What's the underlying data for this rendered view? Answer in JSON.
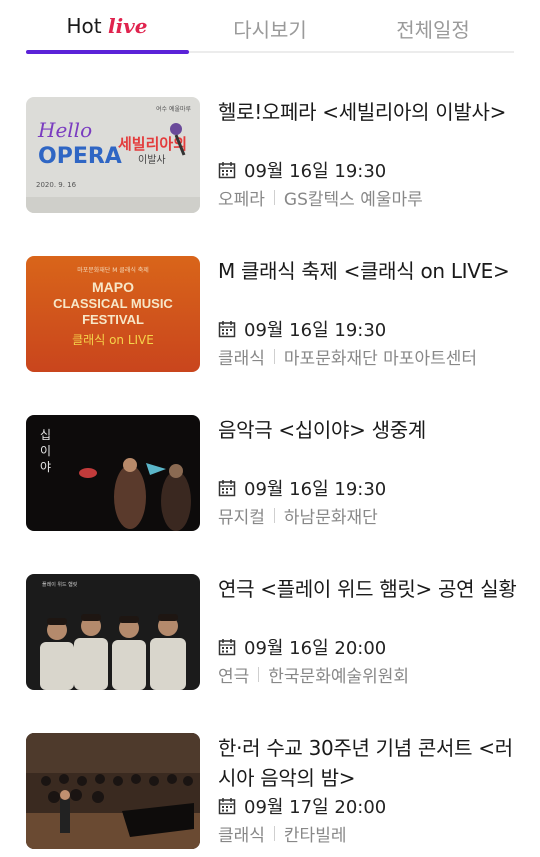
{
  "tabs": {
    "hot_prefix": "Hot",
    "hot_live": "live",
    "replay": "다시보기",
    "schedule": "전체일정"
  },
  "events": [
    {
      "title": "헬로!오페라 <세빌리아의 이발사>",
      "date": "09월 16일 19:30",
      "category": "오페라",
      "venue": "GS칼텍스 예울마루",
      "poster": {
        "line1": "Hello",
        "line2": "OPERA",
        "kr": "세빌리아의",
        "kr2": "이발사",
        "date": "2020. 9. 16",
        "top": "여수 예울마루"
      }
    },
    {
      "title": "M 클래식 축제 <클래식 on LIVE>",
      "date": "09월 16일 19:30",
      "category": "클래식",
      "venue": "마포문화재단 마포아트센터",
      "poster": {
        "top": "마포문화재단 M 클래식 축제",
        "line1": "MAPO",
        "line2": "CLASSICAL MUSIC",
        "line3": "FESTIVAL",
        "line4": "클래식 on LIVE"
      }
    },
    {
      "title": "음악극 <십이야> 생중계",
      "date": "09월 16일 19:30",
      "category": "뮤지컬",
      "venue": "하남문화재단",
      "poster": {
        "vert1": "십",
        "vert2": "이",
        "vert3": "야"
      }
    },
    {
      "title": "연극 <플레이 위드 햄릿> 공연 실황",
      "date": "09월 16일 20:00",
      "category": "연극",
      "venue": "한국문화예술위원회",
      "poster": {
        "top": "플레이 위드 햄릿"
      }
    },
    {
      "title": "한·러 수교 30주년 기념 콘서트 <러시아 음악의 밤>",
      "date": "09월 17일 20:00",
      "category": "클래식",
      "venue": "칸타빌레",
      "poster": {}
    }
  ],
  "colors": {
    "accent": "#5b22d8",
    "live": "#e0234e",
    "meta": "#888888"
  }
}
